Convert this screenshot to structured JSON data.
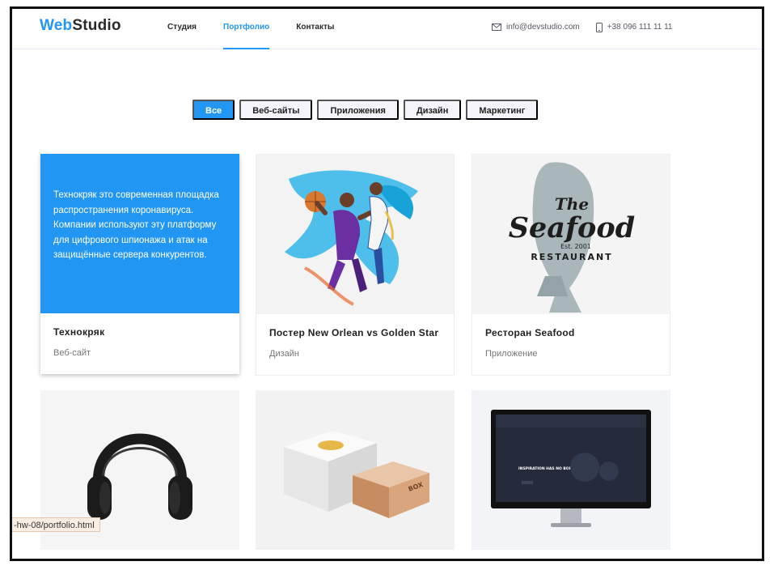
{
  "brand": {
    "part1": "Web",
    "part2": "Studio"
  },
  "nav": {
    "items": [
      "Студия",
      "Портфолио",
      "Контакты"
    ],
    "active_index": 1
  },
  "contacts": {
    "email": "info@devstudio.com",
    "phone": "+38 096 111 11 11"
  },
  "filters": {
    "items": [
      "Все",
      "Веб-сайты",
      "Приложения",
      "Дизайн",
      "Маркетинг"
    ],
    "active_index": 0
  },
  "cards": [
    {
      "title": "Технокряк",
      "type": "Веб-сайт",
      "overlay": "Технокряк это современная площадка распространения коронавируса. Компании используют эту платформу для цифрового шпионажа и атак на защищённые сервера конкурентов."
    },
    {
      "title": "Постер New Orlean vs Golden Star",
      "type": "Дизайн"
    },
    {
      "title": "Ресторан Seafood",
      "type": "Приложение"
    },
    {
      "title": "",
      "type": ""
    },
    {
      "title": "",
      "type": ""
    },
    {
      "title": "",
      "type": ""
    }
  ],
  "images": {
    "seafood_logo": {
      "line1": "The",
      "line2": "Seafood",
      "line3": "Est. 2001",
      "line4": "RESTAURANT"
    },
    "box_label": "BOX",
    "screen_text": "INSPIRATION HAS NO BORDERS"
  },
  "status_bar": {
    "url": "-hw-08/portfolio.html"
  },
  "colors": {
    "accent": "#2196f3",
    "filter_bg": "#f5f4fa",
    "text": "#212121",
    "muted": "#757575"
  }
}
